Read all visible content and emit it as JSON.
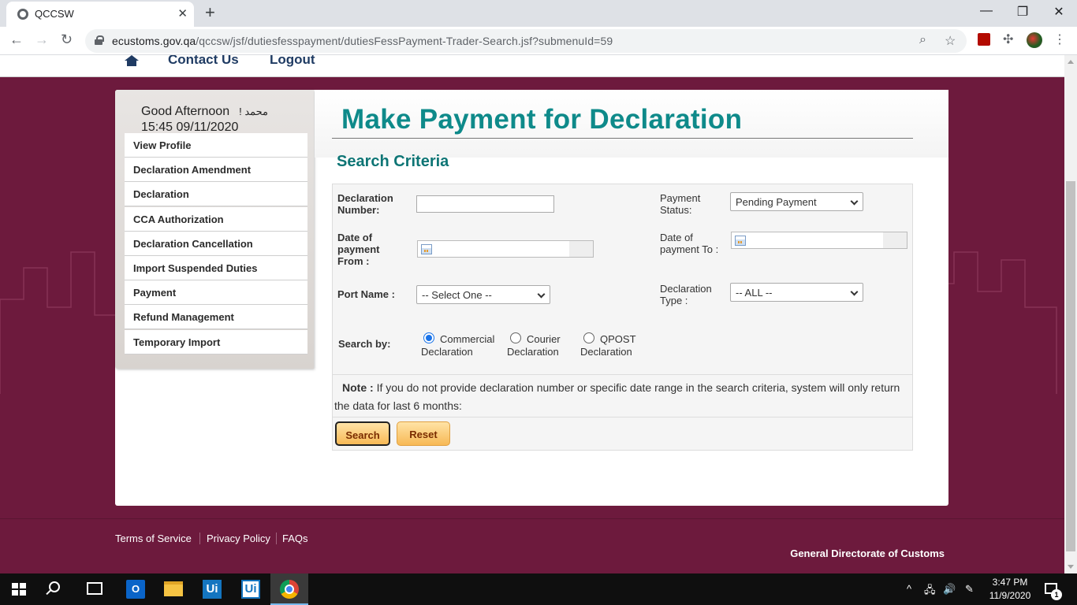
{
  "browser": {
    "tab_title": "QCCSW",
    "url_host": "ecustoms.gov.qa",
    "url_path": "/qccsw/jsf/dutiesfesspayment/dutiesFessPayment-Trader-Search.jsf?submenuId=59"
  },
  "topnav": {
    "contact": "Contact Us",
    "logout": "Logout"
  },
  "sidebar": {
    "greeting": "Good Afternoon",
    "user_suffix": "! محمد",
    "datetime": "15:45 09/11/2020",
    "items": [
      {
        "label": "View Profile"
      },
      {
        "label": "Declaration Amendment"
      },
      {
        "label": "Declaration"
      },
      {
        "label": "CCA Authorization"
      },
      {
        "label": "Declaration Cancellation"
      },
      {
        "label": "Import Suspended Duties"
      },
      {
        "label": "Payment"
      },
      {
        "label": "Refund Management"
      },
      {
        "label": "Temporary Import"
      }
    ]
  },
  "main": {
    "title": "Make Payment for Declaration",
    "subtitle": "Search Criteria"
  },
  "form": {
    "decl_number_label_1": "Declaration",
    "decl_number_label_2": "Number:",
    "decl_number_value": "",
    "payment_status_label_1": "Payment",
    "payment_status_label_2": "Status:",
    "payment_status_value": "Pending Payment",
    "date_from_label_1": "Date of",
    "date_from_label_2": "payment",
    "date_from_label_3": "From :",
    "date_from_value": "",
    "date_to_label_1": "Date of",
    "date_to_label_2": "payment To :",
    "date_to_value": "",
    "port_label": "Port Name :",
    "port_value": "-- Select One --",
    "decl_type_label_1": "Declaration",
    "decl_type_label_2": "Type :",
    "decl_type_value": "-- ALL --",
    "search_by_label": "Search by:",
    "radio_commercial_1": "Commercial",
    "radio_commercial_2": "Declaration",
    "radio_courier_1": "Courier",
    "radio_courier_2": "Declaration",
    "radio_qpost_1": "QPOST",
    "radio_qpost_2": "Declaration",
    "note_label": "Note :",
    "note_text": "If you do not provide declaration number or specific date range in the search criteria, system will only return the data for last 6 months:",
    "search_button": "Search",
    "reset_button": "Reset"
  },
  "footer": {
    "terms": "Terms of Service",
    "privacy": "Privacy Policy",
    "faqs": "FAQs",
    "org": "General Directorate of Customs"
  },
  "taskbar": {
    "time": "3:47 PM",
    "date": "11/9/2020",
    "notifications": "1",
    "outlook_letter": "O",
    "ui_label": "Ui",
    "ui2_label": "Ui"
  },
  "colors": {
    "page_bg": "#6d1a3d",
    "title": "#0e8a8a",
    "nav_link": "#1f3b63",
    "button": "#f7b955"
  }
}
